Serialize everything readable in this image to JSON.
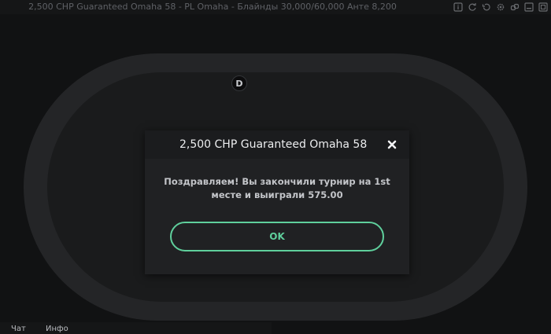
{
  "window": {
    "title": "2,500 CHP Guaranteed Omaha 58 - PL Omaha - Блайнды 30,000/60,000 Анте 8,200"
  },
  "title_icons": [
    {
      "name": "info-icon"
    },
    {
      "name": "refresh-icon"
    },
    {
      "name": "history-icon"
    },
    {
      "name": "settings-icon"
    },
    {
      "name": "link-icon"
    },
    {
      "name": "minimize-icon"
    },
    {
      "name": "maximize-icon"
    }
  ],
  "table": {
    "dealer_label": "D"
  },
  "dialog": {
    "title": "2,500 CHP Guaranteed Omaha 58",
    "message": "Поздравляем! Вы закончили турнир на 1st месте и выиграли 575.00",
    "ok_label": "OK"
  },
  "bottom_tabs": {
    "chat": "Чат",
    "info": "Инфо"
  },
  "colors": {
    "accent": "#5fcf9c",
    "background": "#111213",
    "dialog": "#202123"
  }
}
